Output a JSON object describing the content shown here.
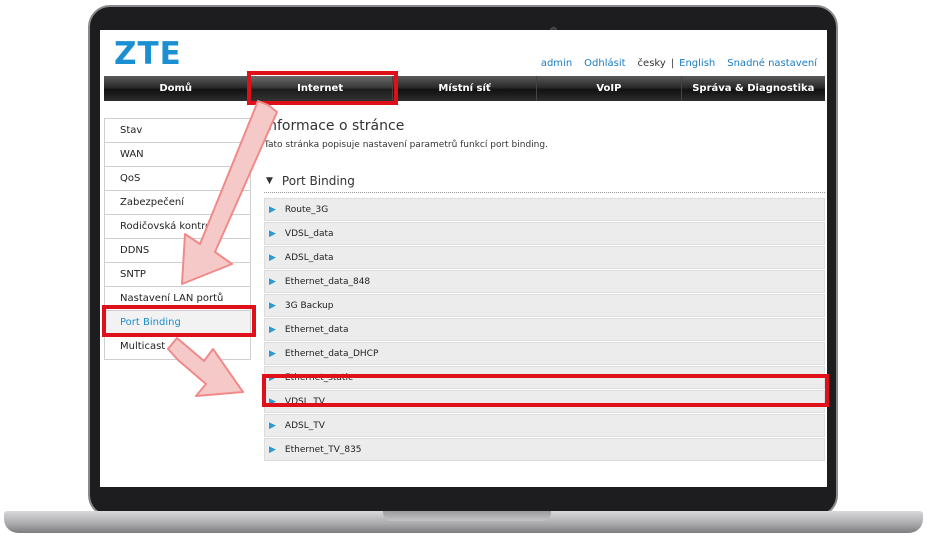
{
  "header": {
    "logo": "ZTE",
    "user": "admin",
    "logout": "Odhlásit",
    "lang_current": "česky",
    "lang_separator": "|",
    "lang_other": "English",
    "easy_setup": "Snadné nastavení"
  },
  "nav": {
    "items": [
      {
        "label": "Domů"
      },
      {
        "label": "Internet"
      },
      {
        "label": "Místní síť"
      },
      {
        "label": "VoIP"
      },
      {
        "label": "Správa & Diagnostika"
      }
    ]
  },
  "sidebar": {
    "items": [
      {
        "label": "Stav"
      },
      {
        "label": "WAN"
      },
      {
        "label": "QoS"
      },
      {
        "label": "Zabezpečení"
      },
      {
        "label": "Rodičovská kontrola"
      },
      {
        "label": "DDNS"
      },
      {
        "label": "SNTP"
      },
      {
        "label": "Nastavení LAN portů"
      },
      {
        "label": "Port Binding"
      },
      {
        "label": "Multicast"
      }
    ]
  },
  "content": {
    "title": "Informace o stránce",
    "description": "Tato stránka popisuje nastavení parametrů funkcí port binding.",
    "section_title": "Port Binding",
    "rows": [
      {
        "label": "Route_3G"
      },
      {
        "label": "VDSL_data"
      },
      {
        "label": "ADSL_data"
      },
      {
        "label": "Ethernet_data_848"
      },
      {
        "label": "3G Backup"
      },
      {
        "label": "Ethernet_data"
      },
      {
        "label": "Ethernet_data_DHCP"
      },
      {
        "label": "Ethernet_static"
      },
      {
        "label": "VDSL_TV"
      },
      {
        "label": "ADSL_TV"
      },
      {
        "label": "Ethernet_TV_835"
      }
    ]
  },
  "colors": {
    "brand": "#1a8fd1",
    "highlight": "#e0101a",
    "arrow_fill": "#f6c9c9",
    "arrow_stroke": "#f08a8a"
  }
}
